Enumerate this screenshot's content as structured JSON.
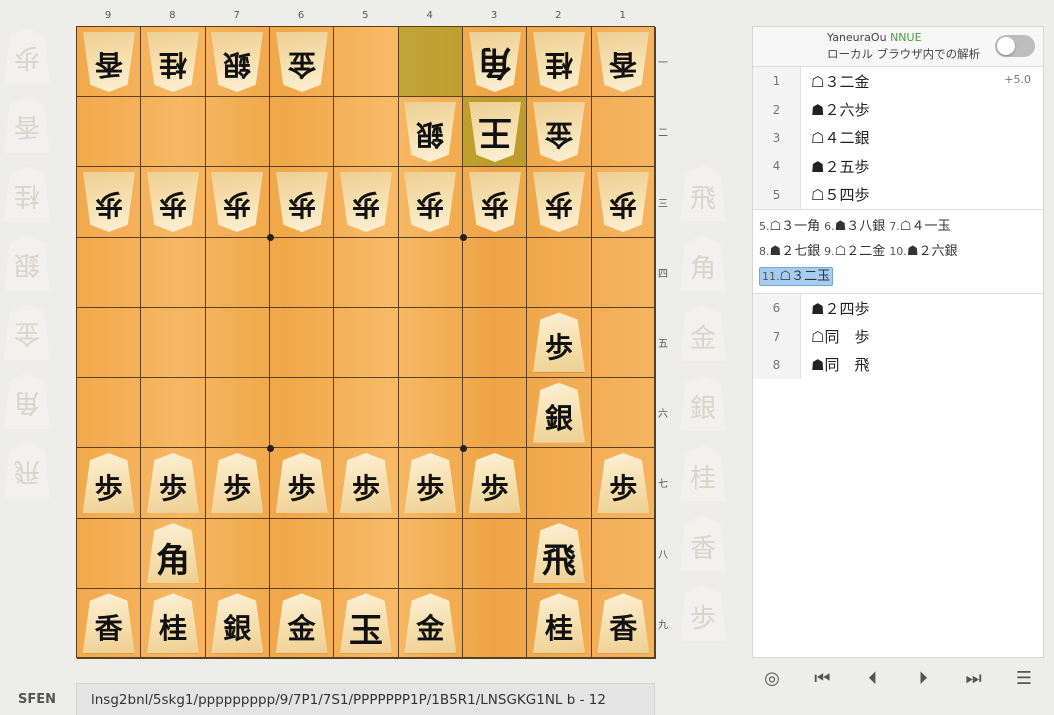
{
  "file_labels": [
    "9",
    "8",
    "7",
    "6",
    "5",
    "4",
    "3",
    "2",
    "1"
  ],
  "rank_labels": [
    "一",
    "二",
    "三",
    "四",
    "五",
    "六",
    "七",
    "八",
    "九"
  ],
  "board": [
    [
      "香",
      "桂",
      "銀",
      "金",
      "",
      "",
      "角",
      "桂",
      "香"
    ],
    [
      "",
      "",
      "",
      "",
      "",
      "銀",
      "王",
      "金",
      ""
    ],
    [
      "歩",
      "歩",
      "歩",
      "歩",
      "歩",
      "歩",
      "歩",
      "歩",
      "歩"
    ],
    [
      "",
      "",
      "",
      "",
      "",
      "",
      "",
      "",
      ""
    ],
    [
      "",
      "",
      "",
      "",
      "",
      "",
      "",
      "歩",
      ""
    ],
    [
      "",
      "",
      "",
      "",
      "",
      "",
      "",
      "銀",
      ""
    ],
    [
      "歩",
      "歩",
      "歩",
      "歩",
      "歩",
      "歩",
      "歩",
      "",
      "歩"
    ],
    [
      "",
      "角",
      "",
      "",
      "",
      "",
      "",
      "飛",
      ""
    ],
    [
      "香",
      "桂",
      "銀",
      "金",
      "玉",
      "金",
      "",
      "桂",
      "香"
    ]
  ],
  "board_owner": [
    [
      "g",
      "g",
      "g",
      "g",
      "",
      "",
      "g",
      "g",
      "g"
    ],
    [
      "",
      "",
      "",
      "",
      "",
      "g",
      "g",
      "g",
      ""
    ],
    [
      "g",
      "g",
      "g",
      "g",
      "g",
      "g",
      "g",
      "g",
      "g"
    ],
    [
      "",
      "",
      "",
      "",
      "",
      "",
      "",
      "",
      ""
    ],
    [
      "",
      "",
      "",
      "",
      "",
      "",
      "",
      "s",
      ""
    ],
    [
      "",
      "",
      "",
      "",
      "",
      "",
      "",
      "s",
      ""
    ],
    [
      "s",
      "s",
      "s",
      "s",
      "s",
      "s",
      "s",
      "",
      "s"
    ],
    [
      "",
      "s",
      "",
      "",
      "",
      "",
      "",
      "s",
      ""
    ],
    [
      "s",
      "s",
      "s",
      "s",
      "s",
      "s",
      "",
      "s",
      "s"
    ]
  ],
  "highlight_cells": [
    [
      0,
      5
    ],
    [
      1,
      6
    ]
  ],
  "gote_hand_ghost": [
    "歩",
    "香",
    "桂",
    "銀",
    "金",
    "角",
    "飛"
  ],
  "sente_hand_ghost": [
    "飛",
    "角",
    "金",
    "銀",
    "桂",
    "香",
    "歩"
  ],
  "engine": {
    "name": "YaneuraOu",
    "tag": "NNUE",
    "subtitle": "ローカル ブラウザ内での解析"
  },
  "moves_top": [
    {
      "num": "1",
      "text": "☖３二金",
      "eval": "+5.0"
    },
    {
      "num": "2",
      "text": "☗２六歩",
      "eval": ""
    },
    {
      "num": "3",
      "text": "☖４二銀",
      "eval": ""
    },
    {
      "num": "4",
      "text": "☗２五歩",
      "eval": ""
    },
    {
      "num": "5",
      "text": "☖５四歩",
      "eval": ""
    }
  ],
  "variation": [
    {
      "num": "5.",
      "text": "☖３一角"
    },
    {
      "num": "6.",
      "text": "☗３八銀"
    },
    {
      "num": "7.",
      "text": "☖４一玉"
    },
    {
      "num": "8.",
      "text": "☗２七銀"
    },
    {
      "num": "9.",
      "text": "☖２二金"
    },
    {
      "num": "10.",
      "text": "☗２六銀"
    },
    {
      "num": "11.",
      "text": "☖３二玉",
      "active": true
    }
  ],
  "moves_bottom": [
    {
      "num": "6",
      "text": "☗２四歩"
    },
    {
      "num": "7",
      "text": "☖同　歩"
    },
    {
      "num": "8",
      "text": "☗同　飛"
    }
  ],
  "controls": {
    "analysis_icon": "◎",
    "first_icon": "⏮",
    "prev_icon": "⏴",
    "next_icon": "⏵",
    "last_icon": "⏭",
    "menu_icon": "☰"
  },
  "sfen": {
    "label": "SFEN",
    "value": "lnsg2bnl/5skg1/ppppppppp/9/7P1/7S1/PPPPPPP1P/1B5R1/LNSGKG1NL b - 12"
  }
}
